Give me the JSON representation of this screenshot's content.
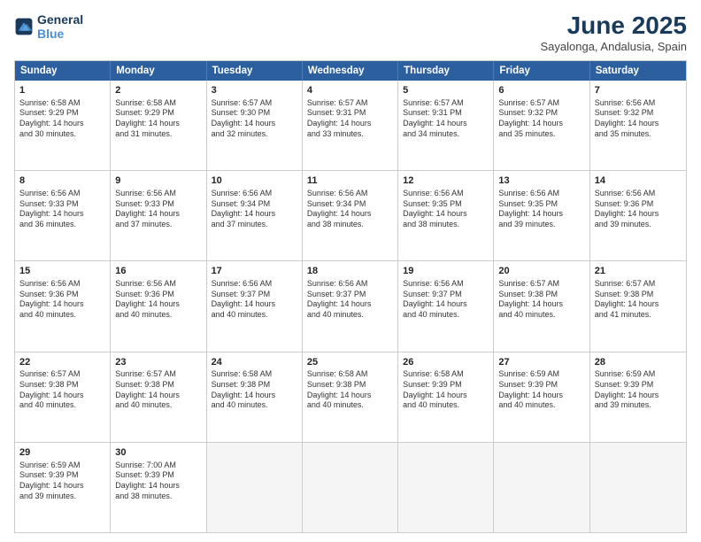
{
  "logo": {
    "line1": "General",
    "line2": "Blue"
  },
  "title": "June 2025",
  "subtitle": "Sayalonga, Andalusia, Spain",
  "header_days": [
    "Sunday",
    "Monday",
    "Tuesday",
    "Wednesday",
    "Thursday",
    "Friday",
    "Saturday"
  ],
  "weeks": [
    [
      {
        "day": "1",
        "lines": [
          "Sunrise: 6:58 AM",
          "Sunset: 9:29 PM",
          "Daylight: 14 hours",
          "and 30 minutes."
        ]
      },
      {
        "day": "2",
        "lines": [
          "Sunrise: 6:58 AM",
          "Sunset: 9:29 PM",
          "Daylight: 14 hours",
          "and 31 minutes."
        ]
      },
      {
        "day": "3",
        "lines": [
          "Sunrise: 6:57 AM",
          "Sunset: 9:30 PM",
          "Daylight: 14 hours",
          "and 32 minutes."
        ]
      },
      {
        "day": "4",
        "lines": [
          "Sunrise: 6:57 AM",
          "Sunset: 9:31 PM",
          "Daylight: 14 hours",
          "and 33 minutes."
        ]
      },
      {
        "day": "5",
        "lines": [
          "Sunrise: 6:57 AM",
          "Sunset: 9:31 PM",
          "Daylight: 14 hours",
          "and 34 minutes."
        ]
      },
      {
        "day": "6",
        "lines": [
          "Sunrise: 6:57 AM",
          "Sunset: 9:32 PM",
          "Daylight: 14 hours",
          "and 35 minutes."
        ]
      },
      {
        "day": "7",
        "lines": [
          "Sunrise: 6:56 AM",
          "Sunset: 9:32 PM",
          "Daylight: 14 hours",
          "and 35 minutes."
        ]
      }
    ],
    [
      {
        "day": "8",
        "lines": [
          "Sunrise: 6:56 AM",
          "Sunset: 9:33 PM",
          "Daylight: 14 hours",
          "and 36 minutes."
        ]
      },
      {
        "day": "9",
        "lines": [
          "Sunrise: 6:56 AM",
          "Sunset: 9:33 PM",
          "Daylight: 14 hours",
          "and 37 minutes."
        ]
      },
      {
        "day": "10",
        "lines": [
          "Sunrise: 6:56 AM",
          "Sunset: 9:34 PM",
          "Daylight: 14 hours",
          "and 37 minutes."
        ]
      },
      {
        "day": "11",
        "lines": [
          "Sunrise: 6:56 AM",
          "Sunset: 9:34 PM",
          "Daylight: 14 hours",
          "and 38 minutes."
        ]
      },
      {
        "day": "12",
        "lines": [
          "Sunrise: 6:56 AM",
          "Sunset: 9:35 PM",
          "Daylight: 14 hours",
          "and 38 minutes."
        ]
      },
      {
        "day": "13",
        "lines": [
          "Sunrise: 6:56 AM",
          "Sunset: 9:35 PM",
          "Daylight: 14 hours",
          "and 39 minutes."
        ]
      },
      {
        "day": "14",
        "lines": [
          "Sunrise: 6:56 AM",
          "Sunset: 9:36 PM",
          "Daylight: 14 hours",
          "and 39 minutes."
        ]
      }
    ],
    [
      {
        "day": "15",
        "lines": [
          "Sunrise: 6:56 AM",
          "Sunset: 9:36 PM",
          "Daylight: 14 hours",
          "and 40 minutes."
        ]
      },
      {
        "day": "16",
        "lines": [
          "Sunrise: 6:56 AM",
          "Sunset: 9:36 PM",
          "Daylight: 14 hours",
          "and 40 minutes."
        ]
      },
      {
        "day": "17",
        "lines": [
          "Sunrise: 6:56 AM",
          "Sunset: 9:37 PM",
          "Daylight: 14 hours",
          "and 40 minutes."
        ]
      },
      {
        "day": "18",
        "lines": [
          "Sunrise: 6:56 AM",
          "Sunset: 9:37 PM",
          "Daylight: 14 hours",
          "and 40 minutes."
        ]
      },
      {
        "day": "19",
        "lines": [
          "Sunrise: 6:56 AM",
          "Sunset: 9:37 PM",
          "Daylight: 14 hours",
          "and 40 minutes."
        ]
      },
      {
        "day": "20",
        "lines": [
          "Sunrise: 6:57 AM",
          "Sunset: 9:38 PM",
          "Daylight: 14 hours",
          "and 40 minutes."
        ]
      },
      {
        "day": "21",
        "lines": [
          "Sunrise: 6:57 AM",
          "Sunset: 9:38 PM",
          "Daylight: 14 hours",
          "and 41 minutes."
        ]
      }
    ],
    [
      {
        "day": "22",
        "lines": [
          "Sunrise: 6:57 AM",
          "Sunset: 9:38 PM",
          "Daylight: 14 hours",
          "and 40 minutes."
        ]
      },
      {
        "day": "23",
        "lines": [
          "Sunrise: 6:57 AM",
          "Sunset: 9:38 PM",
          "Daylight: 14 hours",
          "and 40 minutes."
        ]
      },
      {
        "day": "24",
        "lines": [
          "Sunrise: 6:58 AM",
          "Sunset: 9:38 PM",
          "Daylight: 14 hours",
          "and 40 minutes."
        ]
      },
      {
        "day": "25",
        "lines": [
          "Sunrise: 6:58 AM",
          "Sunset: 9:38 PM",
          "Daylight: 14 hours",
          "and 40 minutes."
        ]
      },
      {
        "day": "26",
        "lines": [
          "Sunrise: 6:58 AM",
          "Sunset: 9:39 PM",
          "Daylight: 14 hours",
          "and 40 minutes."
        ]
      },
      {
        "day": "27",
        "lines": [
          "Sunrise: 6:59 AM",
          "Sunset: 9:39 PM",
          "Daylight: 14 hours",
          "and 40 minutes."
        ]
      },
      {
        "day": "28",
        "lines": [
          "Sunrise: 6:59 AM",
          "Sunset: 9:39 PM",
          "Daylight: 14 hours",
          "and 39 minutes."
        ]
      }
    ],
    [
      {
        "day": "29",
        "lines": [
          "Sunrise: 6:59 AM",
          "Sunset: 9:39 PM",
          "Daylight: 14 hours",
          "and 39 minutes."
        ]
      },
      {
        "day": "30",
        "lines": [
          "Sunrise: 7:00 AM",
          "Sunset: 9:39 PM",
          "Daylight: 14 hours",
          "and 38 minutes."
        ]
      },
      {
        "day": "",
        "lines": []
      },
      {
        "day": "",
        "lines": []
      },
      {
        "day": "",
        "lines": []
      },
      {
        "day": "",
        "lines": []
      },
      {
        "day": "",
        "lines": []
      }
    ]
  ]
}
